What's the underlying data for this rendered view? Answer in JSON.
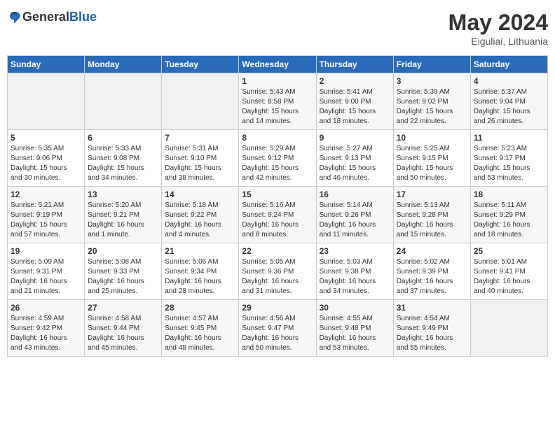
{
  "header": {
    "logo_general": "General",
    "logo_blue": "Blue",
    "month_year": "May 2024",
    "location": "Eiguliai, Lithuania"
  },
  "days_of_week": [
    "Sunday",
    "Monday",
    "Tuesday",
    "Wednesday",
    "Thursday",
    "Friday",
    "Saturday"
  ],
  "weeks": [
    [
      {
        "day": "",
        "content": ""
      },
      {
        "day": "",
        "content": ""
      },
      {
        "day": "",
        "content": ""
      },
      {
        "day": "1",
        "content": "Sunrise: 5:43 AM\nSunset: 8:58 PM\nDaylight: 15 hours\nand 14 minutes."
      },
      {
        "day": "2",
        "content": "Sunrise: 5:41 AM\nSunset: 9:00 PM\nDaylight: 15 hours\nand 18 minutes."
      },
      {
        "day": "3",
        "content": "Sunrise: 5:39 AM\nSunset: 9:02 PM\nDaylight: 15 hours\nand 22 minutes."
      },
      {
        "day": "4",
        "content": "Sunrise: 5:37 AM\nSunset: 9:04 PM\nDaylight: 15 hours\nand 26 minutes."
      }
    ],
    [
      {
        "day": "5",
        "content": "Sunrise: 5:35 AM\nSunset: 9:06 PM\nDaylight: 15 hours\nand 30 minutes."
      },
      {
        "day": "6",
        "content": "Sunrise: 5:33 AM\nSunset: 9:08 PM\nDaylight: 15 hours\nand 34 minutes."
      },
      {
        "day": "7",
        "content": "Sunrise: 5:31 AM\nSunset: 9:10 PM\nDaylight: 15 hours\nand 38 minutes."
      },
      {
        "day": "8",
        "content": "Sunrise: 5:29 AM\nSunset: 9:12 PM\nDaylight: 15 hours\nand 42 minutes."
      },
      {
        "day": "9",
        "content": "Sunrise: 5:27 AM\nSunset: 9:13 PM\nDaylight: 15 hours\nand 46 minutes."
      },
      {
        "day": "10",
        "content": "Sunrise: 5:25 AM\nSunset: 9:15 PM\nDaylight: 15 hours\nand 50 minutes."
      },
      {
        "day": "11",
        "content": "Sunrise: 5:23 AM\nSunset: 9:17 PM\nDaylight: 15 hours\nand 53 minutes."
      }
    ],
    [
      {
        "day": "12",
        "content": "Sunrise: 5:21 AM\nSunset: 9:19 PM\nDaylight: 15 hours\nand 57 minutes."
      },
      {
        "day": "13",
        "content": "Sunrise: 5:20 AM\nSunset: 9:21 PM\nDaylight: 16 hours\nand 1 minute."
      },
      {
        "day": "14",
        "content": "Sunrise: 5:18 AM\nSunset: 9:22 PM\nDaylight: 16 hours\nand 4 minutes."
      },
      {
        "day": "15",
        "content": "Sunrise: 5:16 AM\nSunset: 9:24 PM\nDaylight: 16 hours\nand 8 minutes."
      },
      {
        "day": "16",
        "content": "Sunrise: 5:14 AM\nSunset: 9:26 PM\nDaylight: 16 hours\nand 11 minutes."
      },
      {
        "day": "17",
        "content": "Sunrise: 5:13 AM\nSunset: 9:28 PM\nDaylight: 16 hours\nand 15 minutes."
      },
      {
        "day": "18",
        "content": "Sunrise: 5:11 AM\nSunset: 9:29 PM\nDaylight: 16 hours\nand 18 minutes."
      }
    ],
    [
      {
        "day": "19",
        "content": "Sunrise: 5:09 AM\nSunset: 9:31 PM\nDaylight: 16 hours\nand 21 minutes."
      },
      {
        "day": "20",
        "content": "Sunrise: 5:08 AM\nSunset: 9:33 PM\nDaylight: 16 hours\nand 25 minutes."
      },
      {
        "day": "21",
        "content": "Sunrise: 5:06 AM\nSunset: 9:34 PM\nDaylight: 16 hours\nand 28 minutes."
      },
      {
        "day": "22",
        "content": "Sunrise: 5:05 AM\nSunset: 9:36 PM\nDaylight: 16 hours\nand 31 minutes."
      },
      {
        "day": "23",
        "content": "Sunrise: 5:03 AM\nSunset: 9:38 PM\nDaylight: 16 hours\nand 34 minutes."
      },
      {
        "day": "24",
        "content": "Sunrise: 5:02 AM\nSunset: 9:39 PM\nDaylight: 16 hours\nand 37 minutes."
      },
      {
        "day": "25",
        "content": "Sunrise: 5:01 AM\nSunset: 9:41 PM\nDaylight: 16 hours\nand 40 minutes."
      }
    ],
    [
      {
        "day": "26",
        "content": "Sunrise: 4:59 AM\nSunset: 9:42 PM\nDaylight: 16 hours\nand 43 minutes."
      },
      {
        "day": "27",
        "content": "Sunrise: 4:58 AM\nSunset: 9:44 PM\nDaylight: 16 hours\nand 45 minutes."
      },
      {
        "day": "28",
        "content": "Sunrise: 4:57 AM\nSunset: 9:45 PM\nDaylight: 16 hours\nand 48 minutes."
      },
      {
        "day": "29",
        "content": "Sunrise: 4:56 AM\nSunset: 9:47 PM\nDaylight: 16 hours\nand 50 minutes."
      },
      {
        "day": "30",
        "content": "Sunrise: 4:55 AM\nSunset: 9:48 PM\nDaylight: 16 hours\nand 53 minutes."
      },
      {
        "day": "31",
        "content": "Sunrise: 4:54 AM\nSunset: 9:49 PM\nDaylight: 16 hours\nand 55 minutes."
      },
      {
        "day": "",
        "content": ""
      }
    ]
  ]
}
